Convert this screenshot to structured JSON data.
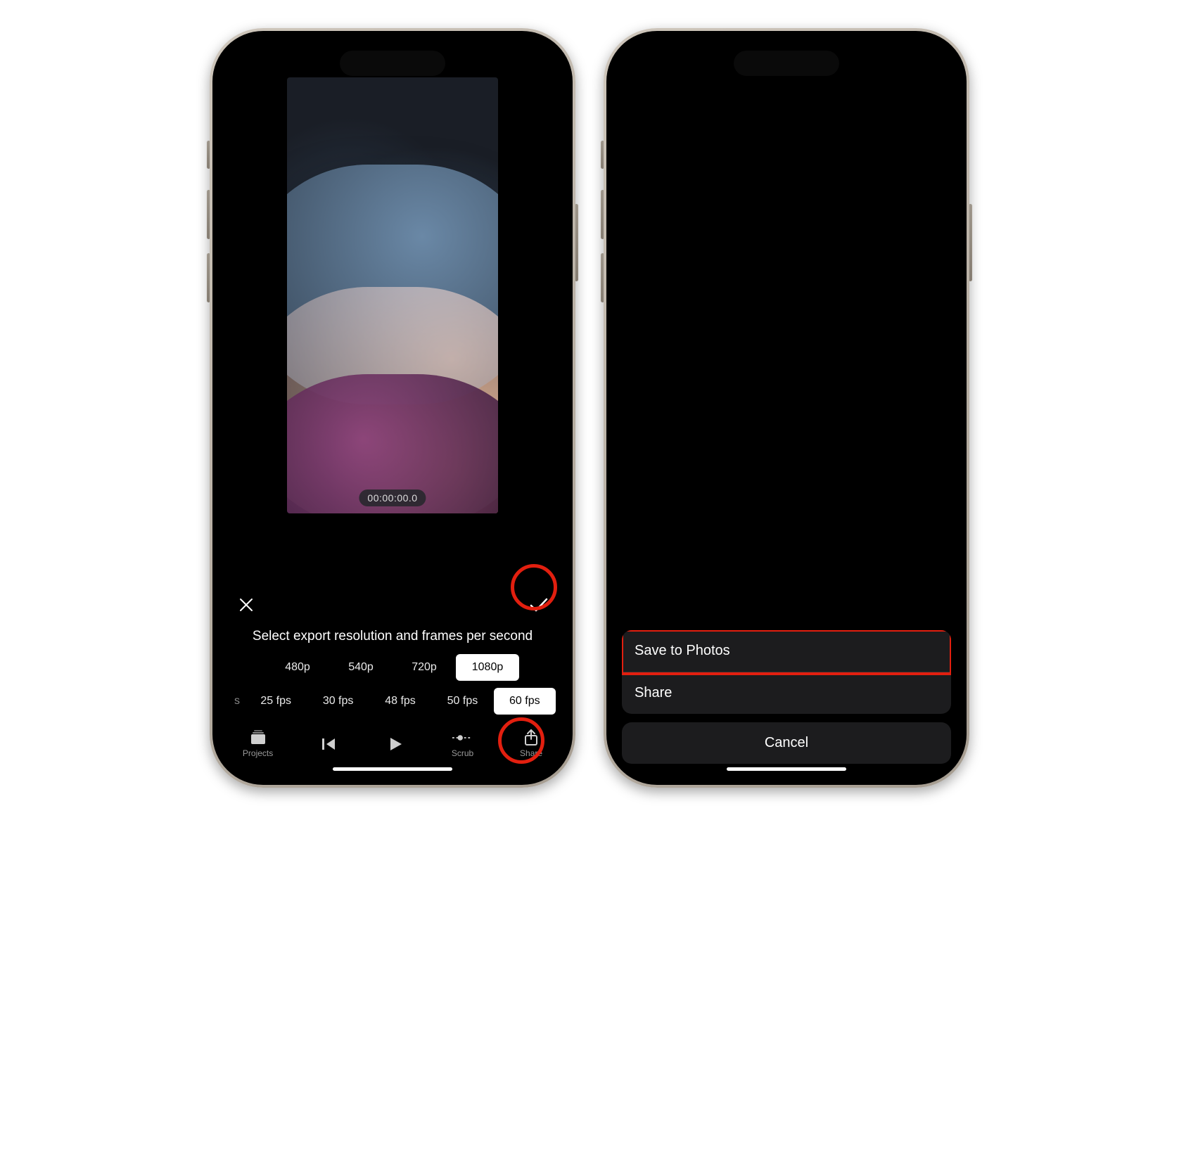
{
  "screen1": {
    "timecode": "00:00:00.0",
    "prompt": "Select export resolution and frames per second",
    "resolutions": [
      "480p",
      "540p",
      "720p",
      "1080p"
    ],
    "selected_resolution": "1080p",
    "fps_truncated_leading": "s",
    "fps": [
      "25 fps",
      "30 fps",
      "48 fps",
      "50 fps",
      "60 fps"
    ],
    "selected_fps": "60 fps",
    "toolbar": {
      "projects": "Projects",
      "scrub": "Scrub",
      "share": "Share"
    }
  },
  "screen2": {
    "actions": {
      "save": "Save to Photos",
      "share": "Share"
    },
    "cancel": "Cancel"
  }
}
